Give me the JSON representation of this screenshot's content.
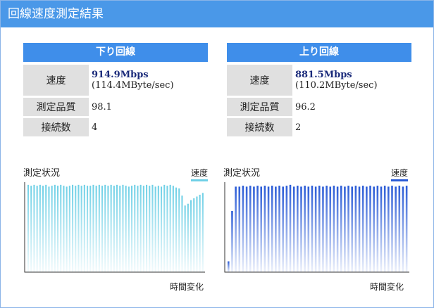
{
  "header": {
    "title": "回線速度測定結果"
  },
  "download": {
    "title": "下り回線",
    "speed_label": "速度",
    "speed_value": "914.9Mbps",
    "speed_sub": "(114.4MByte/sec)",
    "quality_label": "測定品質",
    "quality_value": "98.1",
    "connections_label": "接続数",
    "connections_value": "4",
    "chart_title": "測定状況",
    "legend": "速度",
    "xlabel": "時間変化"
  },
  "upload": {
    "title": "上り回線",
    "speed_label": "速度",
    "speed_value": "881.5Mbps",
    "speed_sub": "(110.2MByte/sec)",
    "quality_label": "測定品質",
    "quality_value": "96.2",
    "connections_label": "接続数",
    "connections_value": "2",
    "chart_title": "測定状況",
    "legend": "速度",
    "xlabel": "時間変化"
  },
  "colors": {
    "header_bg": "#4a98e8",
    "column_title_bg": "#3f8eea",
    "label_bg": "#e0e0e0",
    "speed_text": "#1a2a7a",
    "download_bar": "#6fd0e6",
    "upload_bar": "#2a5bd6"
  },
  "chart_data": [
    {
      "type": "bar",
      "series": [
        {
          "values": [
            97,
            96,
            97,
            96,
            97,
            96,
            97,
            95,
            96,
            97,
            96,
            97,
            96,
            95,
            96,
            97,
            96,
            97,
            96,
            97,
            96,
            96,
            97,
            96,
            97,
            96,
            97,
            96,
            97,
            96,
            97,
            96,
            97,
            96,
            95,
            96,
            97,
            96,
            97,
            96,
            97,
            96,
            97,
            95,
            96,
            95,
            97,
            96,
            97,
            96,
            94,
            93,
            85,
            74,
            76,
            80,
            82,
            84,
            86,
            88
          ]
        }
      ],
      "ylim": [
        0,
        100
      ],
      "grid": false
    },
    {
      "type": "bar",
      "series": [
        {
          "values": [
            12,
            68,
            95,
            95,
            96,
            95,
            96,
            95,
            96,
            95,
            96,
            95,
            96,
            95,
            96,
            95,
            96,
            97,
            95,
            96,
            95,
            96,
            95,
            96,
            95,
            96,
            95,
            96,
            95,
            96,
            95,
            96,
            95,
            96,
            95,
            96,
            95,
            96,
            95,
            96,
            95,
            96,
            95,
            96,
            95,
            96,
            95,
            96,
            95,
            96
          ]
        }
      ],
      "ylim": [
        0,
        100
      ],
      "grid": false
    }
  ]
}
